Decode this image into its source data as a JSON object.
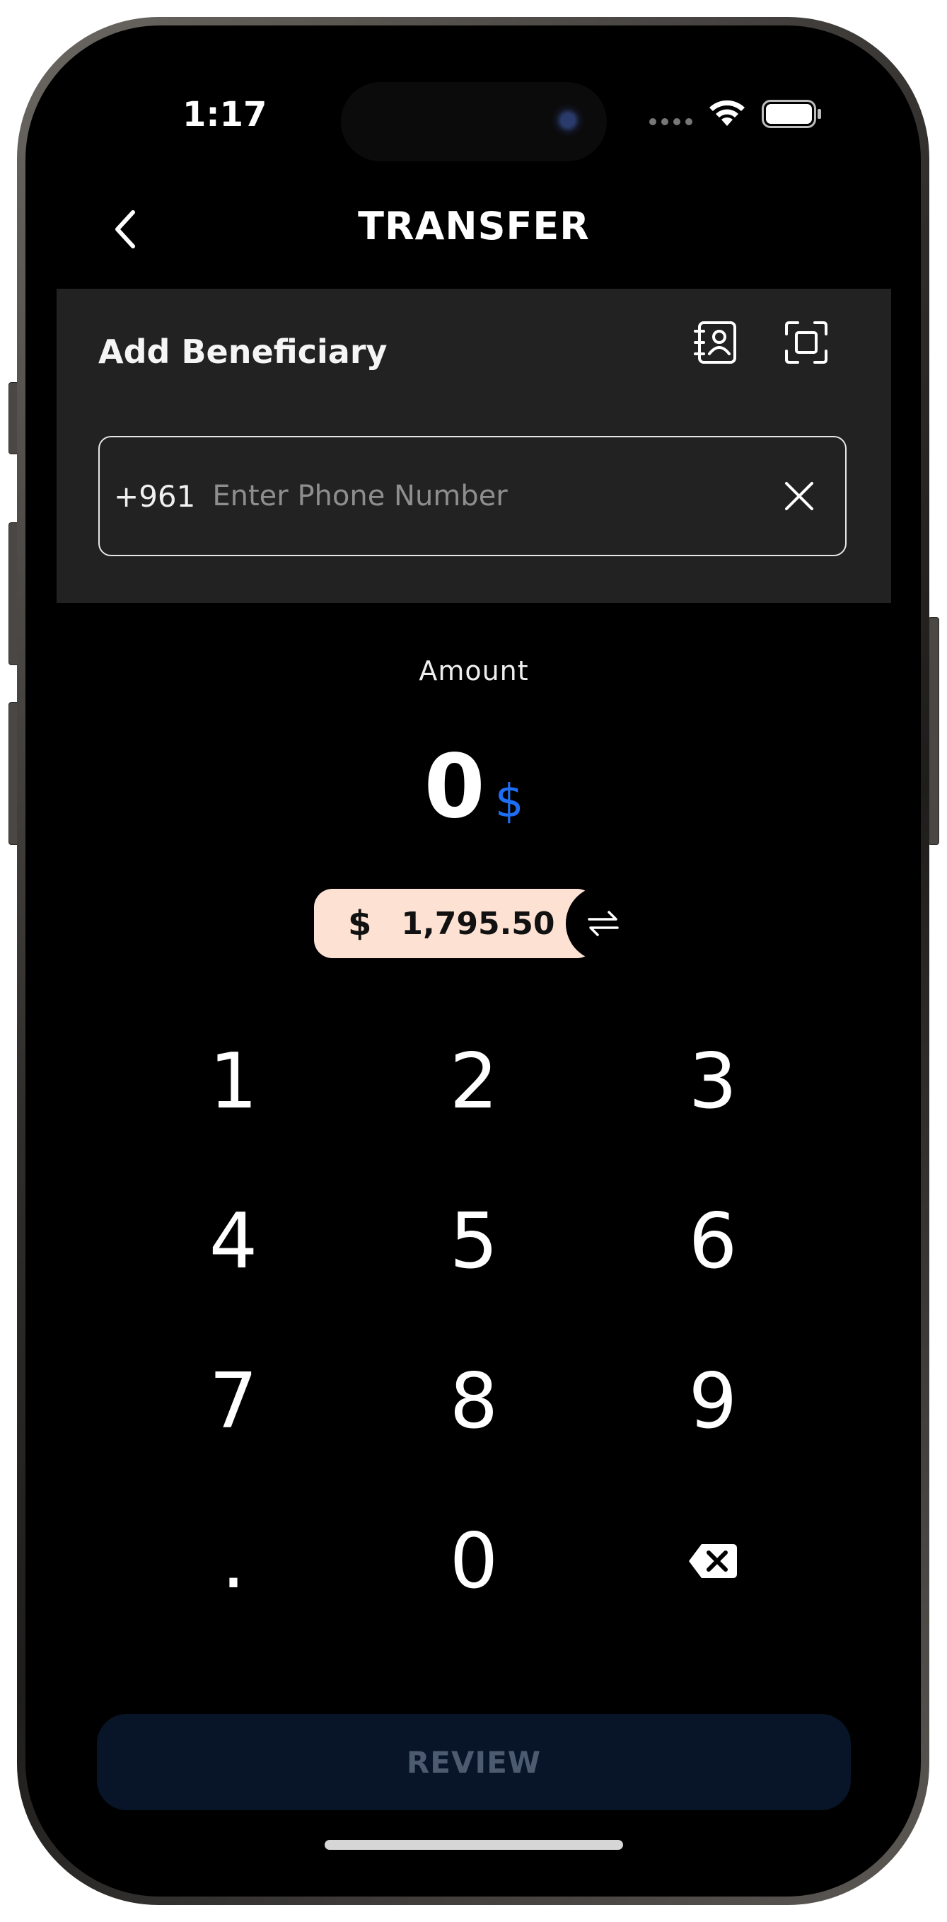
{
  "status_bar": {
    "time": "1:17"
  },
  "header": {
    "title": "TRANSFER"
  },
  "beneficiary": {
    "title": "Add Beneficiary",
    "country_code": "+961",
    "phone_placeholder": "Enter Phone Number",
    "phone_value": ""
  },
  "amount": {
    "label": "Amount",
    "value": "0",
    "currency_symbol": "$"
  },
  "balance": {
    "currency_symbol": "$",
    "value": "1,795.50"
  },
  "keypad": {
    "keys": [
      "1",
      "2",
      "3",
      "4",
      "5",
      "6",
      "7",
      "8",
      "9",
      ".",
      "0"
    ]
  },
  "actions": {
    "review_label": "REVIEW"
  },
  "colors": {
    "accent": "#1E6EF5",
    "panel": "#222222",
    "balance_pill": "#FDE1D3",
    "review_button_disabled": "#081428",
    "review_text_disabled": "#4C5B6F"
  }
}
